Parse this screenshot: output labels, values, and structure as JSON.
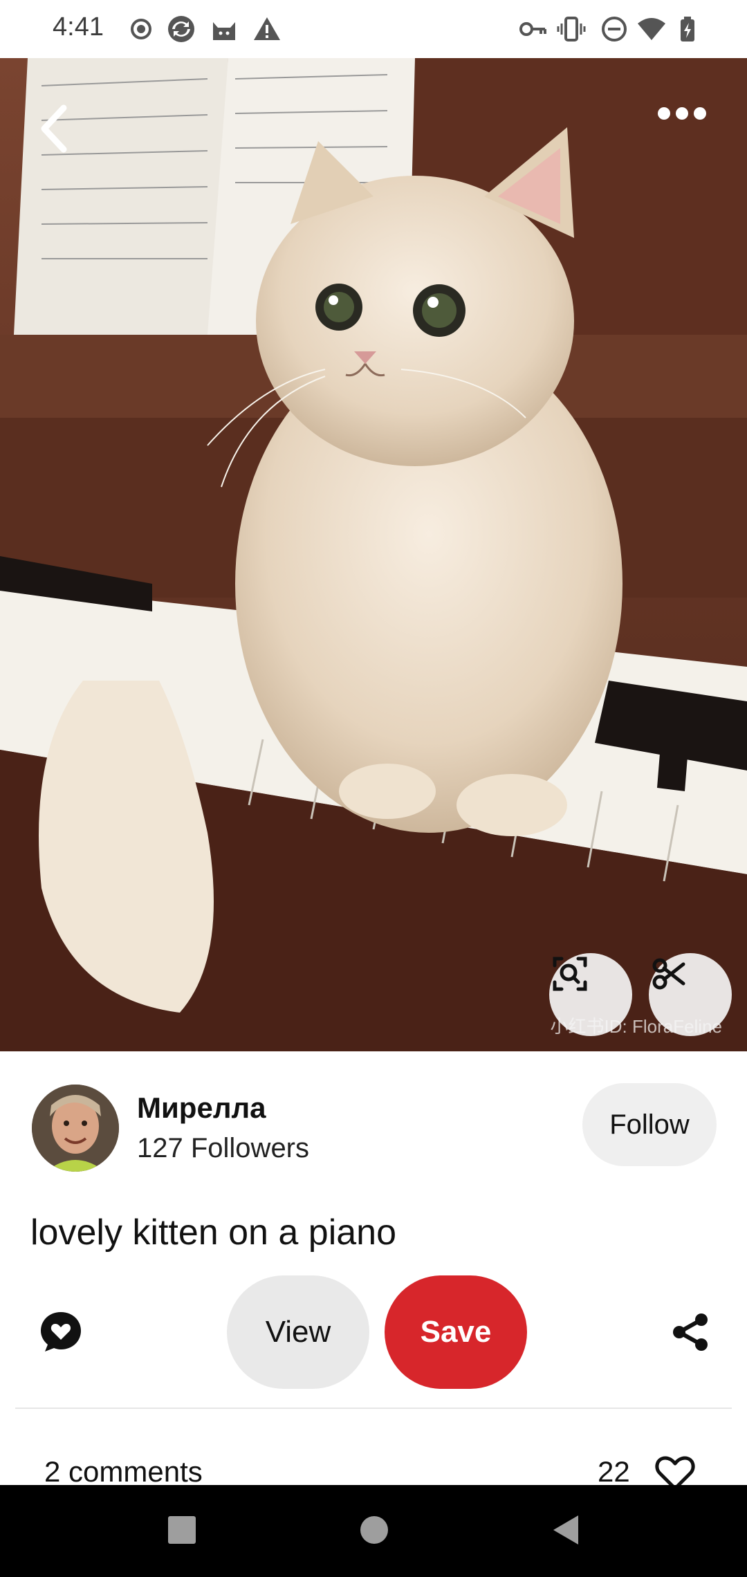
{
  "status_bar": {
    "time": "4:41",
    "left_icons": [
      "record-icon",
      "sync-icon",
      "cat-app-icon",
      "warning-icon"
    ],
    "right_icons": [
      "key-icon",
      "vibrate-icon",
      "do-not-disturb-icon",
      "wifi-icon",
      "battery-icon"
    ]
  },
  "pin": {
    "image_subject": "fluffy cream kitten sitting on piano keys",
    "watermark": "小红书ID: FloraFeline",
    "title": "lovely kitten on a piano"
  },
  "top_bar": {
    "back_icon": "chevron-left-icon",
    "more_icon": "more-horizontal-icon"
  },
  "image_tools": {
    "visual_search_icon": "visual-search-icon",
    "cutout_icon": "scissors-icon"
  },
  "creator": {
    "name": "Мирелла",
    "followers": "127 Followers",
    "follow_label": "Follow"
  },
  "actions": {
    "view_label": "View",
    "save_label": "Save",
    "comment_icon": "comment-heart-icon",
    "share_icon": "share-icon"
  },
  "stats": {
    "comments": "2 comments",
    "likes": "22"
  },
  "colors": {
    "save_red": "#d7262b",
    "view_gray": "#e9e9e9",
    "follow_gray": "#efefef"
  },
  "nav": {
    "recents_icon": "square-icon",
    "home_icon": "circle-icon",
    "back_icon": "triangle-back-icon"
  }
}
